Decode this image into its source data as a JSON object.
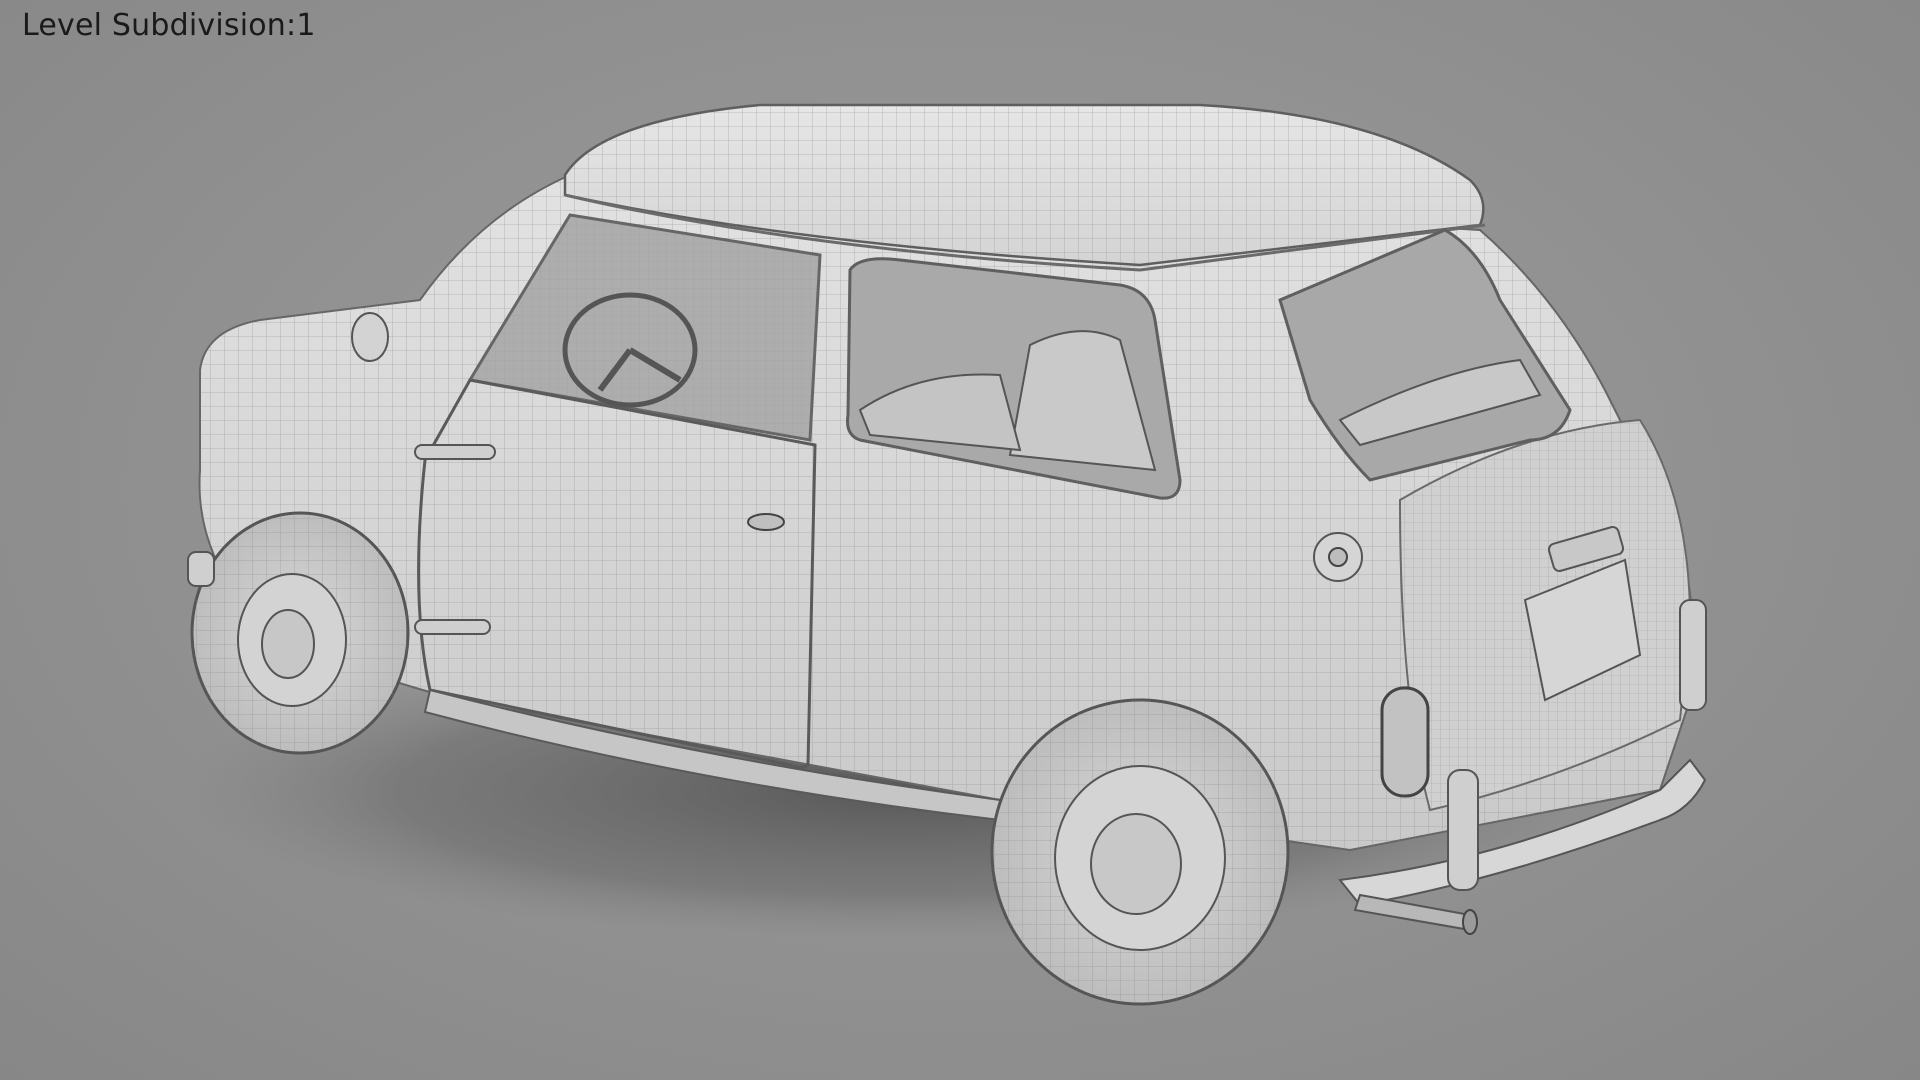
{
  "viewport": {
    "overlay_label": "Level Subdivision:1"
  },
  "render": {
    "subject": "car-wireframe-clay-render",
    "colors": {
      "background": "#939393",
      "body": "#dcdcdc",
      "body_shade": "#c4c4c4",
      "wire": "#6f6f6f",
      "shadow": "#5a5a5a",
      "interior": "#cfcfcf"
    }
  }
}
